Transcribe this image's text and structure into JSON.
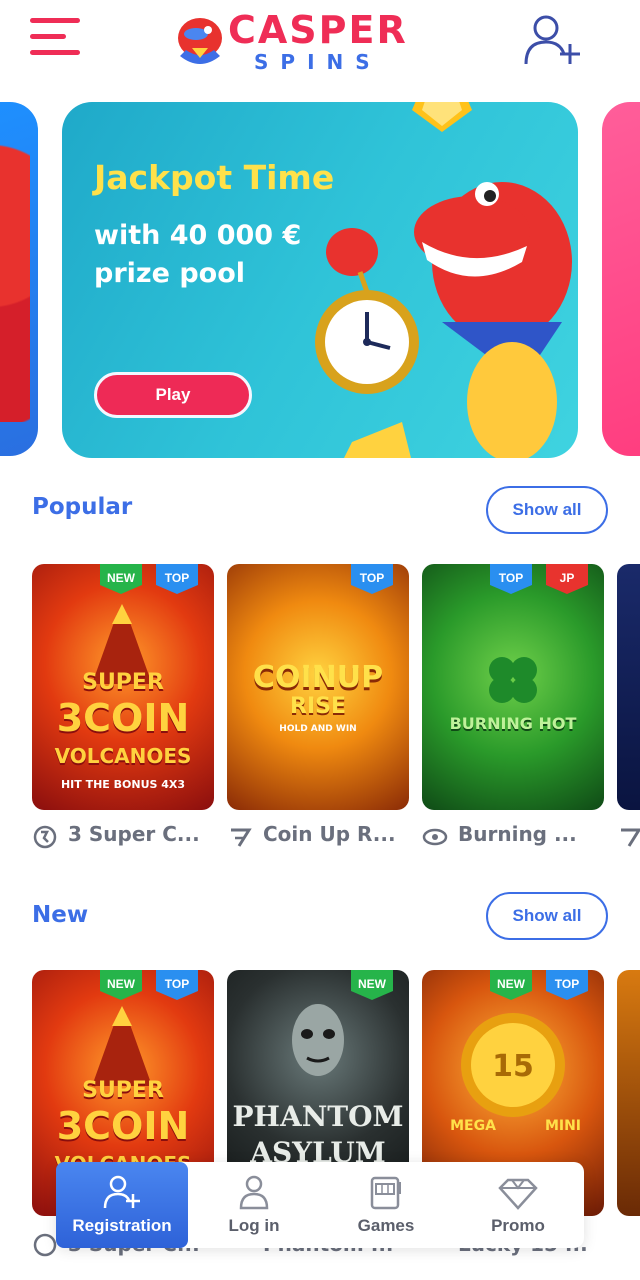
{
  "header": {
    "logo_top": "CASPER",
    "logo_bottom": "SPINS"
  },
  "banner": {
    "title": "Jackpot Time",
    "line1": "with 40 000 €",
    "line2": "prize pool",
    "cta": "Play"
  },
  "popular": {
    "title": "Popular",
    "show_all": "Show all",
    "games": [
      {
        "name": "3 Super C...",
        "badges": [
          "NEW",
          "TOP"
        ],
        "art_line1": "SUPER",
        "art_line2": "3COIN",
        "art_line3": "VOLCANOES",
        "art_line4": "HIT THE BONUS 4X3"
      },
      {
        "name": "Coin Up R...",
        "badges": [
          "TOP"
        ],
        "art_line1": "COINUP",
        "art_line2": "RISE",
        "art_line3": "HOLD AND WIN"
      },
      {
        "name": "Burning ...",
        "badges": [
          "TOP",
          "JP"
        ],
        "art_line1": "BURNING HOT"
      }
    ]
  },
  "new": {
    "title": "New",
    "show_all": "Show all",
    "games": [
      {
        "name": "3 Super C...",
        "badges": [
          "NEW",
          "TOP"
        ],
        "art_line1": "SUPER",
        "art_line2": "3COIN",
        "art_line3": "VOLCANOES"
      },
      {
        "name": "Phantom ...",
        "badges": [
          "NEW"
        ],
        "art_line1": "PHANTOM",
        "art_line2": "ASYLUM"
      },
      {
        "name": "Lucky 15 ...",
        "badges": [
          "NEW",
          "TOP"
        ],
        "art_line1": "MEGA",
        "art_line2": "MINI"
      }
    ]
  },
  "bottom_nav": [
    {
      "label": "Registration",
      "icon": "user-add-icon",
      "active": true
    },
    {
      "label": "Log in",
      "icon": "user-icon",
      "active": false
    },
    {
      "label": "Games",
      "icon": "slot-machine-icon",
      "active": false
    },
    {
      "label": "Promo",
      "icon": "diamond-icon",
      "active": false
    }
  ],
  "colors": {
    "brand_red": "#ef2d56",
    "brand_blue": "#3c6ee6",
    "banner_yellow": "#ffe14a"
  }
}
